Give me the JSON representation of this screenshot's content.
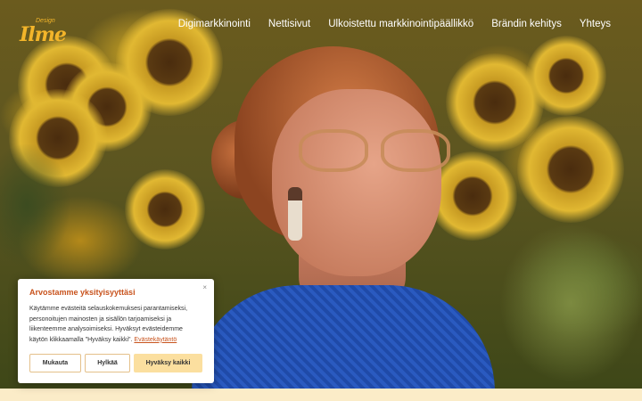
{
  "header": {
    "logo_text": "Ilme",
    "logo_small": "Design",
    "nav": [
      "Digimarkkinointi",
      "Nettisivut",
      "Ulkoistettu markkinointipäällikkö",
      "Brändin kehitys",
      "Yhteys"
    ]
  },
  "cookie": {
    "title": "Arvostamme yksityisyyttäsi",
    "close_icon": "×",
    "text": "Käytämme evästeitä selauskokemuksesi parantamiseksi, personoitujen mainosten ja sisällön tarjoamiseksi ja liikenteemme analysoimiseksi. Hyväksyt evästeidemme käytön klikkaamalla \"Hyväksy kaikki\".",
    "link": "Evästekäytäntö",
    "buttons": {
      "customize": "Mukauta",
      "reject": "Hylkää",
      "accept": "Hyväksy kaikki"
    }
  },
  "colors": {
    "accent": "#f3b52a",
    "cookie_title": "#c8531d",
    "accept_bg": "#fbdf9f",
    "footer_strip": "#fbecc8"
  }
}
